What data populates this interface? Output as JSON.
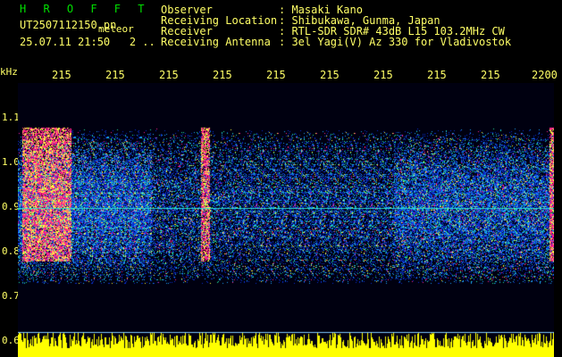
{
  "header": {
    "title": "H R O F F T",
    "file": "UT2507112150.pn",
    "tag": "meteor",
    "date": "25.07.11 21:50",
    "date_suffix": "2 .."
  },
  "info": [
    {
      "label": "Observer",
      "value": ": Masaki Kano"
    },
    {
      "label": "Receiving Location",
      "value": ": Shibukawa, Gunma, Japan"
    },
    {
      "label": "Receiver",
      "value": ": RTL-SDR SDR# 43dB L15 103.2MHz CW"
    },
    {
      "label": "Receiving Antenna",
      "value": ": 3el Yagi(V) Az 330 for Vladivostok"
    }
  ],
  "axis": {
    "unit": "kHz",
    "y_ticks": [
      "1.1",
      "1.0",
      "0.9",
      "0.8",
      "0.7",
      "0.6"
    ],
    "x_ticks": [
      "215",
      "215",
      "215",
      "215",
      "215",
      "215",
      "215",
      "215",
      "215",
      "2200"
    ]
  },
  "colors": {
    "background": "#000000",
    "text": "#ffff66",
    "title": "#00e000",
    "power_plot": "#ffff00"
  }
}
